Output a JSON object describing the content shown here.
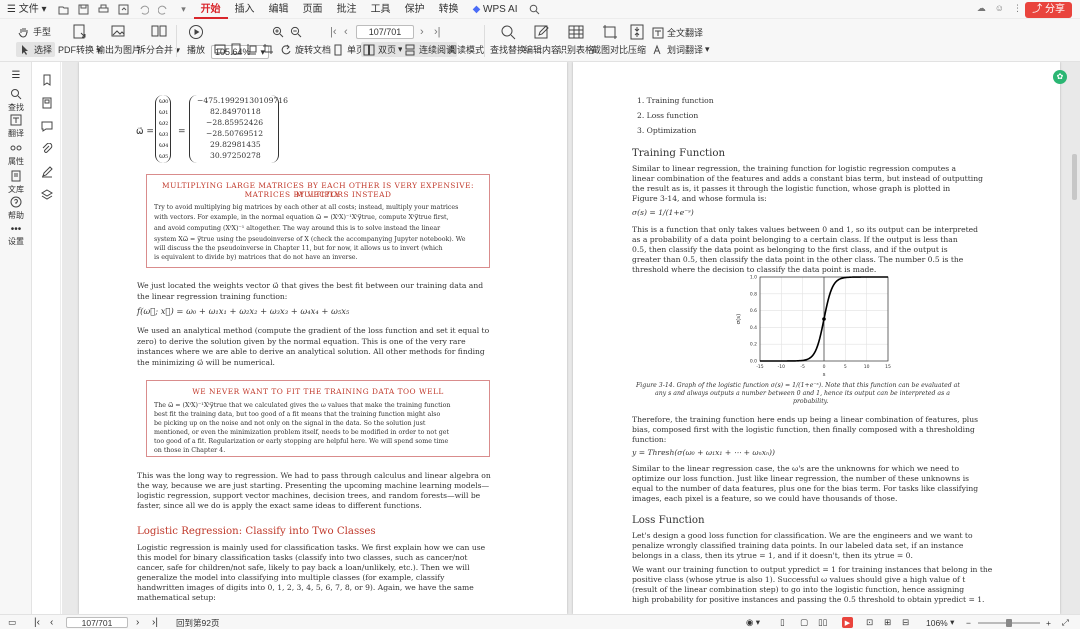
{
  "menubar": {
    "file": "文件",
    "tabs": [
      "开始",
      "插入",
      "编辑",
      "页面",
      "批注",
      "工具",
      "保护",
      "转换",
      "WPS AI"
    ],
    "active_tab": "开始",
    "share": "分享"
  },
  "toolbar": {
    "hand": "手型",
    "select": "选择",
    "pdf_convert": "PDF转换",
    "to_image": "输出为图片",
    "split_merge": "拆分合并",
    "play": "播放",
    "zoom": "105.64%",
    "rotate": "旋转文档",
    "single": "单页",
    "double": "双页",
    "continuous": "连续阅读",
    "reading_mode": "阅读模式",
    "page_current": "107/701",
    "find_replace": "查找替换",
    "edit_content": "编辑内容",
    "recognize_table": "识别表格",
    "screenshot_compare": "截图对比",
    "compress": "压缩",
    "full_translate": "全文翻译",
    "word_translate": "划词翻译"
  },
  "leftbar": [
    "查找",
    "翻译",
    "属性",
    "文库",
    "帮助",
    "设置"
  ],
  "accent": "#d9262c",
  "left_page": {
    "vector_values": [
      "−475.19929130109716",
      "82.84970118",
      "−28.85952426",
      "−28.50769512",
      "29.82981435",
      "30.97250278"
    ],
    "omega_labels": [
      "ω₀",
      "ω₁",
      "ω₂",
      "ω₃",
      "ω₄",
      "ω₅"
    ],
    "callout1": {
      "title": [
        "MULTIPLYING LARGE MATRICES BY EACH OTHER IS VERY EXPENSIVE: MULTIPLY",
        "MATRICES BY VECTORS INSTEAD"
      ],
      "lines": [
        "Try to avoid multiplying big matrices by each other at all costs; instead, multiply your matrices",
        "with vectors. For example, in the normal equation ω⃗ = (XᵗX)⁻¹Xᵗy⃗true, compute Xᵗy⃗true first,",
        "and avoid computing (XᵗX)⁻¹ altogether. The way around this is to solve instead the linear",
        "system Xω⃗ = y⃗true using the pseudoinverse of X (check the accompanying Jupyter notebook). We",
        "will discuss the the pseudoinverse in Chapter 11, but for now, it allows us to invert (which",
        "is equivalent to divide by) matrices that do not have an inverse."
      ]
    },
    "para1": [
      "We just located the weights vector ω⃗ that gives the best fit between our training data and",
      "the linear regression training function:"
    ],
    "equation": "f(ω⃗; x⃗) = ω₀ + ω₁x₁ + ω₂x₂ + ω₃x₃ + ω₄x₄ + ω₅x₅",
    "para2": [
      "We used an analytical method (compute the gradient of the loss function and set it equal to",
      "zero) to derive the solution given by the normal equation. This is one of the very rare",
      "instances where we are able to derive an analytical solution. All other methods for finding",
      "the minimizing ω⃗ will be numerical."
    ],
    "callout2": {
      "title": "WE NEVER WANT TO FIT THE TRAINING DATA TOO WELL",
      "lines": [
        "The ω⃗ = (XᵗX)⁻¹Xᵗy⃗true that we calculated gives the ω values that make the training function",
        "best fit the training data, but too good of a fit means that the training function might also",
        "be picking up on the noise and not only on the signal in the data. So the solution just",
        "mentioned, or even the minimization problem itself, needs to be modified in order to not get",
        "too good of a fit. Regularization or early stopping are helpful here. We will spend some time",
        "on those in Chapter 4."
      ]
    },
    "para3": [
      "This was the long way to regression. We had to pass through calculus and linear algebra on",
      "the way, because we are just starting. Presenting the upcoming machine learning models—",
      "logistic regression, support vector machines, decision trees, and random forests—will be",
      "faster, since all we do is apply the exact same ideas to different functions."
    ],
    "heading": "Logistic Regression: Classify into Two Classes",
    "para4": [
      "Logistic regression is mainly used for classification tasks. We first explain how we can use",
      "this model for binary classification tasks (classify into two classes, such as cancer/not",
      "cancer, safe for children/not safe, likely to pay back a loan/unlikely, etc.). Then we will",
      "generalize the model into classifying into multiple classes (for example, classify",
      "handwritten images of digits into 0, 1, 2, 3, 4, 5, 6, 7, 8, or 9). Again, we have the same",
      "mathematical setup:"
    ]
  },
  "right_page": {
    "list": [
      "1.  Training function",
      "2.  Loss function",
      "3.  Optimization"
    ],
    "heading1": "Training Function",
    "para1": [
      "Similar to linear regression, the training function for logistic regression computes a",
      "linear combination of the features and adds a constant bias term, but instead of outputting",
      "the result as is, it passes it through the logistic function, whose graph is plotted in",
      "Figure 3-14, and whose formula is:"
    ],
    "formula1": "σ(s) = 1/(1+e⁻ˢ)",
    "para2": [
      "This is a function that only takes values between 0 and 1, so its output can be interpreted",
      "as a probability of a data point belonging to a certain class. If the output is less than",
      "0.5, then classify the data point as belonging to the first class, and if the output is",
      "greater than 0.5, then classify the data point in the other class. The number 0.5 is the",
      "threshold where the decision to classify the data point is made."
    ],
    "caption": [
      "Figure 3-14. Graph of the logistic function σ(s) = 1/(1+e⁻ˢ). Note that this function can be evaluated at",
      "any s and always outputs a number between 0 and 1, hence its output can be interpreted as a",
      "probability."
    ],
    "para3": [
      "Therefore, the training function here ends up being a linear combination of features, plus",
      "bias, composed first with the logistic function, then finally composed with a thresholding",
      "function:"
    ],
    "formula2": "y = Thresh(σ(ω₀ + ω₁x₁ + ⋯ + ωₙxₙ))",
    "para4": [
      "Similar to the linear regression case, the ω's are the unknowns for which we need to",
      "optimize our loss function. Just like linear regression, the number of these unknowns is",
      "equal to the number of data features, plus one for the bias term. For tasks like classifying",
      "images, each pixel is a feature, so we could have thousands of those."
    ],
    "heading2": "Loss Function",
    "para5": [
      "Let's design a good loss function for classification. We are the engineers and we want to",
      "penalize wrongly classified training data points. In our labeled data set, if an instance",
      "belongs in a class, then its ytrue = 1, and if it doesn't, then its ytrue = 0."
    ],
    "para6": [
      "We want our training function to output ypredict = 1 for training instances that belong in the",
      "positive class (whose ytrue is also 1). Successful ω values should give a high value of t",
      "(result of the linear combination step) to go into the logistic function, hence assigning",
      "high probability for positive instances and passing the 0.5 threshold to obtain ypredict = 1."
    ]
  },
  "chart_data": {
    "type": "line",
    "title": "",
    "xlabel": "s",
    "ylabel": "σ(s)",
    "xlim": [
      -15,
      15
    ],
    "ylim": [
      0,
      1
    ],
    "xticks": [
      -15,
      -10,
      -5,
      0,
      5,
      10,
      15
    ],
    "yticks": [
      0.0,
      0.2,
      0.4,
      0.6,
      0.8,
      1.0
    ],
    "grid": true,
    "function": "1/(1+exp(-s))",
    "marked_point": {
      "x": 0,
      "y": 0.5
    }
  },
  "statusbar": {
    "page": "107/701",
    "back": "回到第92页",
    "zoom": "106%"
  }
}
